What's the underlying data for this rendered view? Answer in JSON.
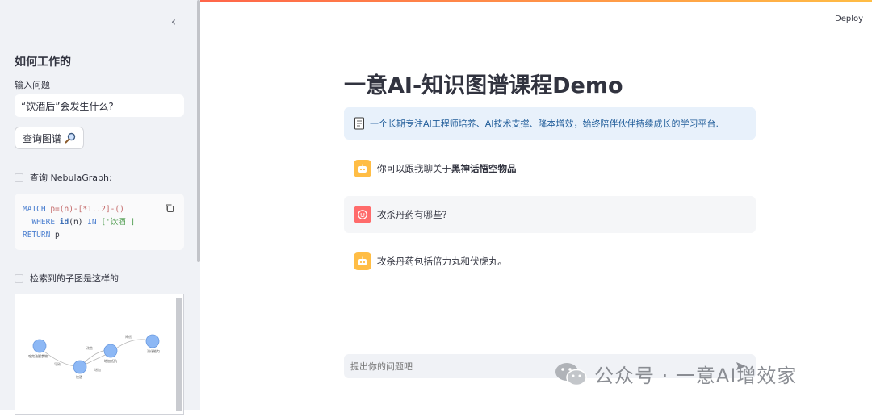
{
  "sidebar": {
    "collapse_icon": "chevron-left-icon",
    "title": "如何工作的",
    "input_label": "输入问题",
    "input_value": "“饮酒后”会发生什么?",
    "query_button": "查询图谱",
    "query_check_label": "查询 NebulaGraph:",
    "code": {
      "line1_kw": "MATCH",
      "line1_rest": " p=(n)-[*1..2]-()",
      "line2_kw1": "WHERE",
      "line2_fn": "id",
      "line2_mid": "(n) ",
      "line2_kw2": "IN",
      "line2_str": "['饮酒']",
      "line3_kw": "RETURN",
      "line3_rest": " p"
    },
    "subgraph_check_label": "检索到的子图是这样的",
    "graph": {
      "nodes": [
        "吃完油腻食物",
        "饮酒",
        "增加抵抗",
        "消化能力"
      ],
      "edges": [
        "导致",
        "增加",
        "降低",
        "改善"
      ]
    }
  },
  "header": {
    "deploy_label": "Deploy"
  },
  "main": {
    "title": "一意AI-知识图谱课程Demo",
    "info_text": "一个长期专注AI工程师培养、AI技术支撑、降本增效，始终陪伴伙伴持续成长的学习平台.",
    "messages": [
      {
        "role": "assistant",
        "prefix": "你可以跟我聊关于",
        "bold": "黑神话悟空物品"
      },
      {
        "role": "user",
        "text": "攻杀丹药有哪些?"
      },
      {
        "role": "assistant",
        "text": "攻杀丹药包括倍力丸和伏虎丸。"
      }
    ],
    "chat_placeholder": "提出你的问题吧"
  },
  "watermark": {
    "text": "公众号 · 一意AI增效家"
  },
  "colors": {
    "accent": "#ff4b4b",
    "bot_avatar": "#ffbd45",
    "user_avatar": "#ff6b6b",
    "info_bg": "#e8f1fb",
    "node": "#8db8f5"
  }
}
